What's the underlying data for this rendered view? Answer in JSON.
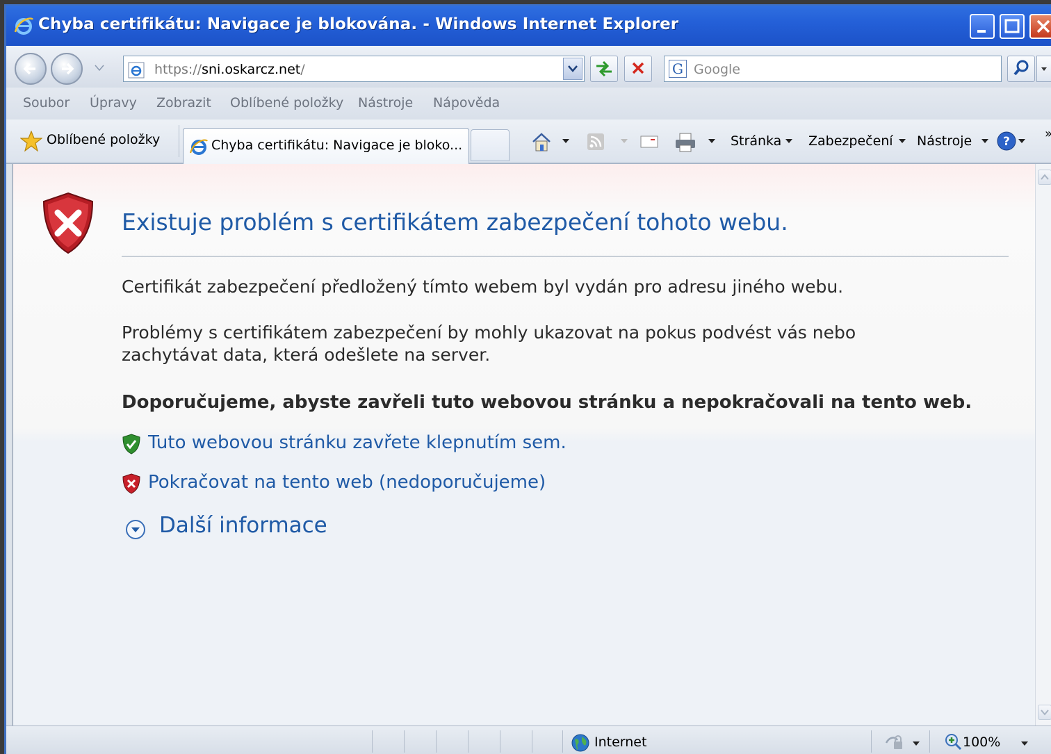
{
  "window": {
    "title": "Chyba certifikátu: Navigace je blokována. - Windows Internet Explorer"
  },
  "address_bar": {
    "url_protocol": "https://",
    "url_host": "sni.oskarcz.net",
    "url_trail": "/"
  },
  "search": {
    "placeholder": "Google",
    "provider_icon": "G"
  },
  "menu": {
    "items": [
      "Soubor",
      "Úpravy",
      "Zobrazit",
      "Oblíbené položky",
      "Nástroje",
      "Nápověda"
    ]
  },
  "tabbar": {
    "favorites_label": "Oblíbené položky",
    "active_tab_label": "Chyba certifikátu: Navigace je bloko...",
    "page_label": "Stránka",
    "security_label": "Zabezpečení",
    "tools_label": "Nástroje",
    "more_glyph": "»"
  },
  "content": {
    "title": "Existuje problém s certifikátem zabezpečení tohoto webu.",
    "paragraph1": "Certifikát zabezpečení předložený tímto webem byl vydán pro adresu jiného webu.",
    "paragraph2_line1": "Problémy s certifikátem zabezpečení by mohly ukazovat na pokus podvést vás nebo",
    "paragraph2_line2": "zachytávat data, která odešlete na server.",
    "recommendation": "Doporučujeme, abyste zavřeli tuto webovou stránku a nepokračovali na tento web.",
    "close_link": "Tuto webovou stránku zavřete klepnutím sem.",
    "continue_link": "Pokračovat na tento web (nedoporučujeme)",
    "more_info": "Další informace"
  },
  "statusbar": {
    "zone_label": "Internet",
    "zoom_label": "100%"
  },
  "colors": {
    "titlebar": "#2460d8",
    "link_blue": "#1f5aa6",
    "error_red": "#c8202a",
    "ok_green": "#2f8f2f"
  },
  "icons": {
    "app": "ie-logo-icon",
    "error": "red-shield-x-icon",
    "ok": "green-shield-check-icon",
    "expand": "expand-circle-icon",
    "zone": "globe-icon"
  }
}
